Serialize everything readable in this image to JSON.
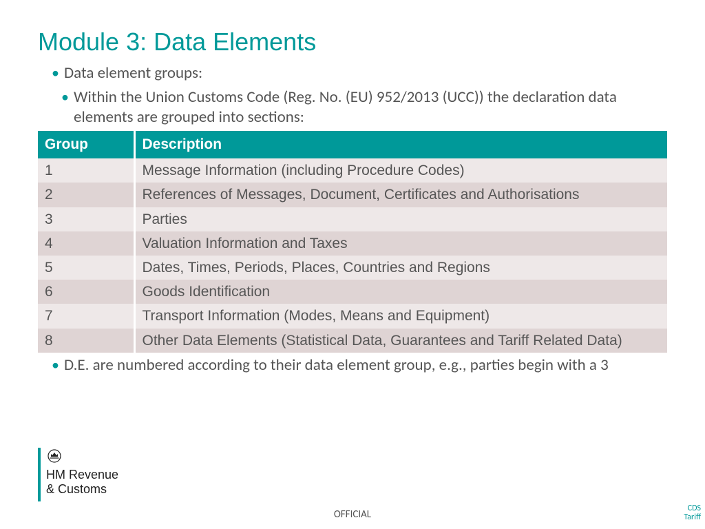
{
  "title": "Module 3: Data Elements",
  "bullets": {
    "line1": "Data element groups:",
    "line2": "Within the Union Customs Code (Reg. No. (EU) 952/2013 (UCC)) the declaration data elements are grouped into sections:",
    "line3": "D.E. are numbered according to their data element group, e.g., parties begin with a 3"
  },
  "table": {
    "headers": {
      "group": "Group",
      "description": "Description"
    },
    "rows": [
      {
        "group": "1",
        "desc": "Message Information (including Procedure Codes)"
      },
      {
        "group": "2",
        "desc": "References of Messages, Document, Certificates and Authorisations"
      },
      {
        "group": "3",
        "desc": "Parties"
      },
      {
        "group": "4",
        "desc": "Valuation Information and Taxes"
      },
      {
        "group": "5",
        "desc": "Dates, Times, Periods, Places, Countries and Regions"
      },
      {
        "group": "6",
        "desc": "Goods Identification"
      },
      {
        "group": "7",
        "desc": "Transport Information (Modes, Means and Equipment)"
      },
      {
        "group": "8",
        "desc": "Other Data Elements (Statistical Data, Guarantees and Tariff Related Data)"
      }
    ]
  },
  "logo": {
    "line1": "HM Revenue",
    "line2": "& Customs"
  },
  "footer": {
    "classification": "OFFICIAL",
    "side": "CDS Tariff"
  }
}
